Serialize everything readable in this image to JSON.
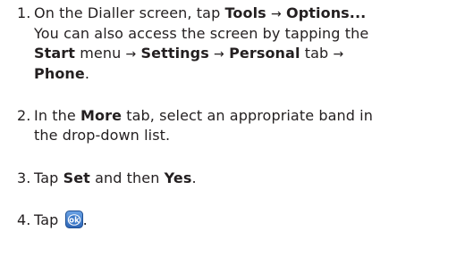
{
  "steps": [
    {
      "number": "1.",
      "line1": {
        "a": "On the Dialler screen, tap ",
        "b": "Tools",
        "arrow1": "→",
        "c": "Options..."
      },
      "line2": "You can also access the screen by tapping the",
      "line3": {
        "a": "Start",
        "b": " menu ",
        "arrow1": "→",
        "c": "Settings",
        "arrow2": "→",
        "d": "Personal",
        "e": " tab ",
        "arrow3": "→"
      },
      "line4": {
        "a": "Phone",
        "b": "."
      }
    },
    {
      "number": "2.",
      "line1": {
        "a": "In the ",
        "b": "More",
        "c": " tab, select an appropriate band in"
      },
      "line2": "the drop-down list."
    },
    {
      "number": "3.",
      "line1": {
        "a": "Tap ",
        "b": "Set",
        "c": " and then ",
        "d": "Yes",
        "e": "."
      }
    },
    {
      "number": "4.",
      "line1": {
        "a": "Tap ",
        "icon": "ok-icon",
        "b": "."
      }
    }
  ],
  "colors": {
    "text": "#231f20",
    "ok_icon_bg": "#3a78c9",
    "ok_icon_text": "#ffffff"
  }
}
